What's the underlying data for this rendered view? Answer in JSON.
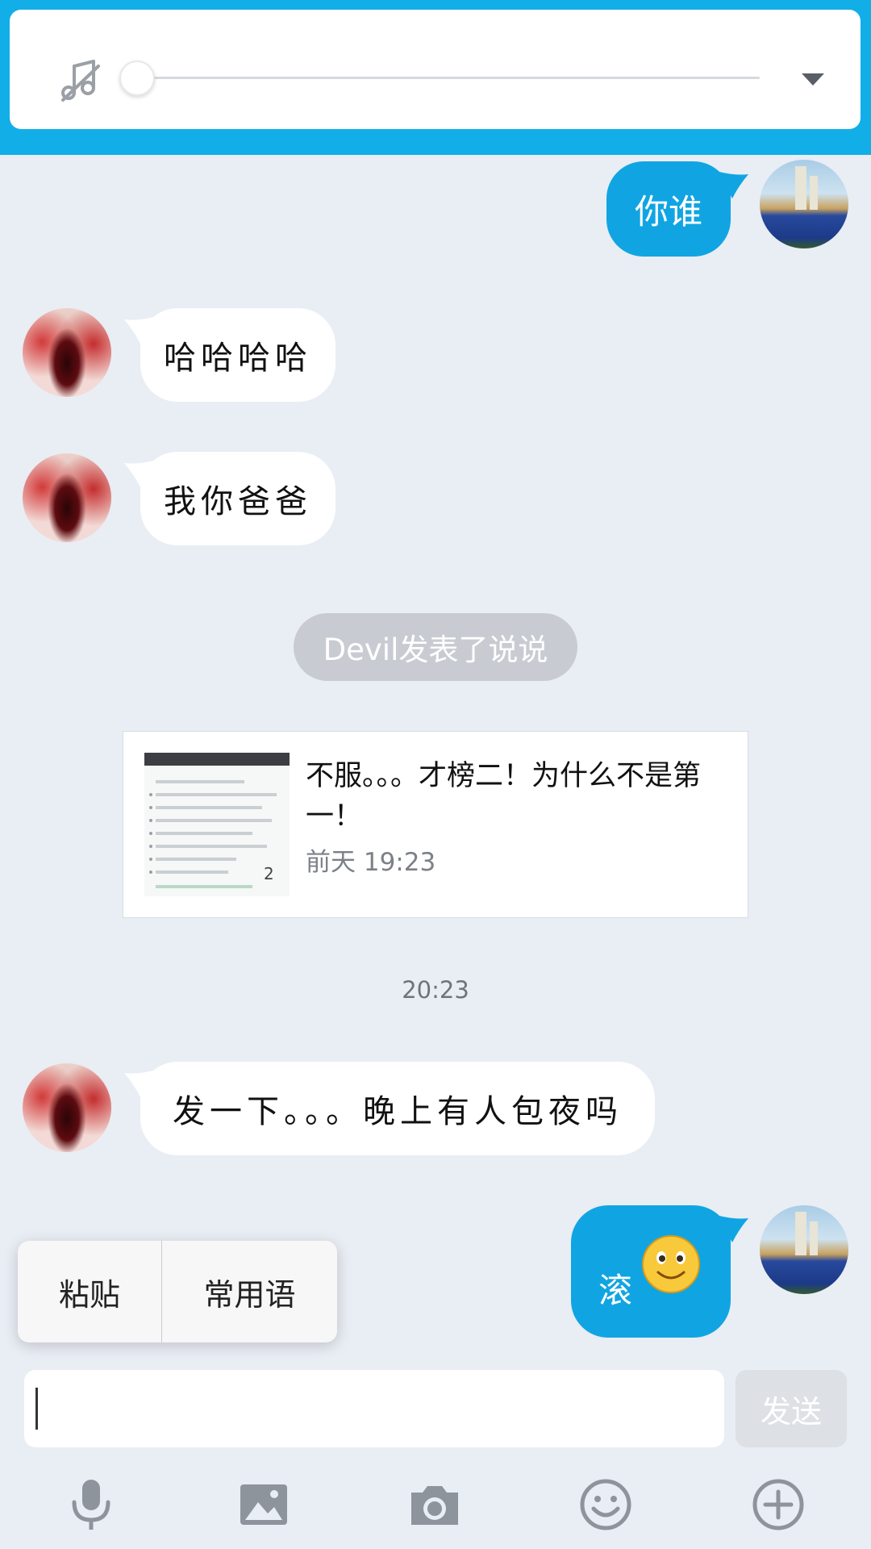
{
  "player": {
    "icon": "music-note-icon",
    "progress_fraction": 0.0,
    "dropdown_icon": "chevron-down-icon"
  },
  "messages": [
    {
      "direction": "out",
      "text": "你谁",
      "avatar": "self-avatar"
    },
    {
      "direction": "in",
      "text": "哈哈哈哈",
      "avatar": "devil-avatar"
    },
    {
      "direction": "in",
      "text": "我你爸爸",
      "avatar": "devil-avatar"
    },
    {
      "direction": "in",
      "text": "发一下。。。晚上有人包夜吗",
      "avatar": "devil-avatar"
    },
    {
      "direction": "out",
      "text": "滚",
      "emoji": "smile-emoji",
      "avatar": "self-avatar"
    }
  ],
  "system": {
    "notice": "Devil发表了说说"
  },
  "post": {
    "text": "不服。。。才榜二！为什么不是第一！",
    "time": "前天 19:23",
    "thumb_badge": "2"
  },
  "timestamp": "20:23",
  "context_menu": {
    "items": [
      "粘贴",
      "常用语"
    ]
  },
  "input": {
    "value": "",
    "send_label": "发送"
  },
  "toolbar": {
    "icons": [
      "microphone-icon",
      "image-icon",
      "camera-icon",
      "emoji-icon",
      "plus-icon"
    ]
  },
  "colors": {
    "accent": "#12aee8",
    "bubble_out": "#10a5e2",
    "background": "#e9edf4",
    "pill": "#c8ccd2",
    "icon_gray": "#8e949c"
  }
}
